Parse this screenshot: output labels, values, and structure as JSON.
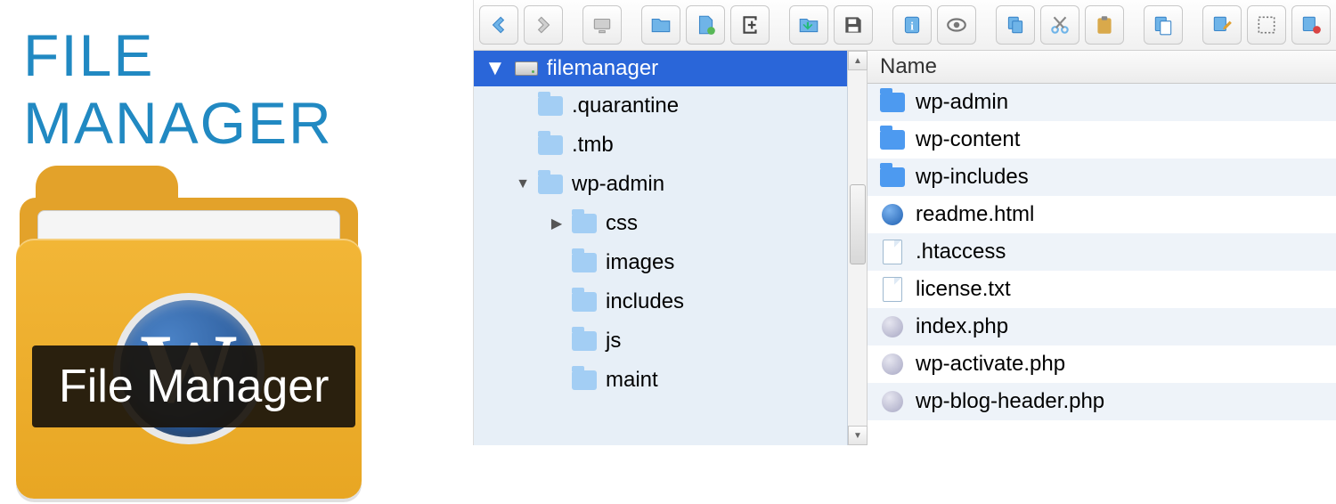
{
  "promo": {
    "headline": "FILE MANAGER",
    "overlay_title": "File Manager",
    "logo_glyph": "W"
  },
  "toolbar": {
    "buttons": [
      {
        "name": "back-button"
      },
      {
        "name": "forward-button"
      },
      {
        "name": "net-mount-button"
      },
      {
        "name": "new-folder-button"
      },
      {
        "name": "new-file-button"
      },
      {
        "name": "upload-button"
      },
      {
        "name": "download-button"
      },
      {
        "name": "save-button"
      },
      {
        "name": "info-button"
      },
      {
        "name": "preview-button"
      },
      {
        "name": "copy-button"
      },
      {
        "name": "cut-button"
      },
      {
        "name": "paste-button"
      },
      {
        "name": "duplicate-button"
      },
      {
        "name": "rename-button"
      },
      {
        "name": "select-all-button"
      },
      {
        "name": "trash-button"
      }
    ]
  },
  "tree": {
    "root": "filemanager",
    "items": [
      {
        "label": ".quarantine",
        "depth": 1,
        "expandable": false
      },
      {
        "label": ".tmb",
        "depth": 1,
        "expandable": false
      },
      {
        "label": "wp-admin",
        "depth": 1,
        "expandable": true,
        "open": true
      },
      {
        "label": "css",
        "depth": 2,
        "expandable": true,
        "open": false
      },
      {
        "label": "images",
        "depth": 2,
        "expandable": false
      },
      {
        "label": "includes",
        "depth": 2,
        "expandable": false
      },
      {
        "label": "js",
        "depth": 2,
        "expandable": false
      },
      {
        "label": "maint",
        "depth": 2,
        "expandable": false
      }
    ]
  },
  "listing": {
    "column_header": "Name",
    "rows": [
      {
        "name": "wp-admin",
        "type": "folder"
      },
      {
        "name": "wp-content",
        "type": "folder"
      },
      {
        "name": "wp-includes",
        "type": "folder"
      },
      {
        "name": "readme.html",
        "type": "html"
      },
      {
        "name": ".htaccess",
        "type": "text"
      },
      {
        "name": "license.txt",
        "type": "text"
      },
      {
        "name": "index.php",
        "type": "php"
      },
      {
        "name": "wp-activate.php",
        "type": "php"
      },
      {
        "name": "wp-blog-header.php",
        "type": "php"
      }
    ]
  }
}
